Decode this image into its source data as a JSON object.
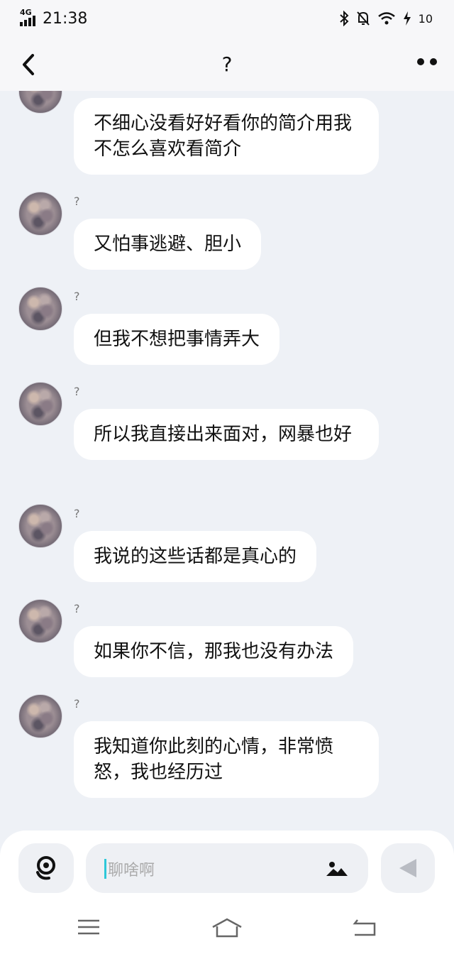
{
  "status_bar": {
    "network": "4G",
    "time": "21:38",
    "battery": "10"
  },
  "header": {
    "title": "?"
  },
  "messages": [
    {
      "sender": "?",
      "text": "不细心没看好好看你的简介用我不怎么喜欢看简介"
    },
    {
      "sender": "?",
      "text": "又怕事逃避、胆小"
    },
    {
      "sender": "?",
      "text": "但我不想把事情弄大"
    },
    {
      "sender": "?",
      "text": "所以我直接出来面对，网暴也好"
    },
    {
      "sender": "?",
      "text": "我说的这些话都是真心的"
    },
    {
      "sender": "?",
      "text": "如果你不信，那我也没有办法"
    },
    {
      "sender": "?",
      "text": "我知道你此刻的心情，非常愤怒，我也经历过"
    }
  ],
  "composer": {
    "placeholder": "聊啥啊"
  },
  "icons": {
    "back": "chevron-left-icon",
    "more": "more-dots-icon",
    "voice": "voice-icon",
    "image": "image-icon",
    "send": "send-icon",
    "menu": "menu-icon",
    "home": "home-icon",
    "return": "back-nav-icon"
  }
}
